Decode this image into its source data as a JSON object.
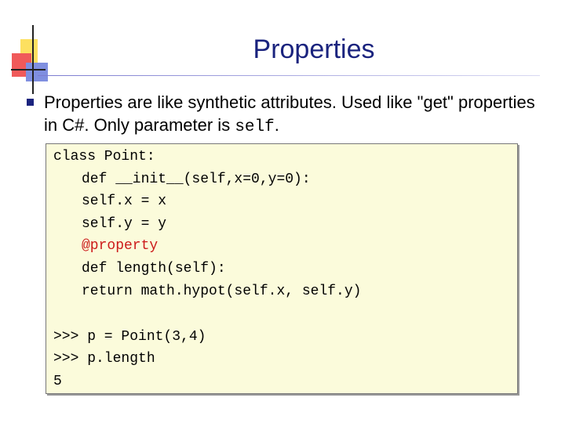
{
  "slide": {
    "title": "Properties",
    "intro_text": "Properties are like synthetic attributes.  Used like \"get\" properties in C#.  Only parameter is ",
    "intro_code": "self",
    "intro_end": "."
  },
  "code": {
    "lines": [
      "class Point:",
      "def __init__(self,x=0,y=0):",
      "self.x = x",
      "self.y = y",
      "@property",
      "def length(self):",
      "return math.hypot(self.x, self.y)",
      ">>> p = Point(3,4)",
      ">>> p.length",
      "5"
    ]
  },
  "colors": {
    "title": "#1a237e",
    "code_bg": "#fbfbdb",
    "decorator": "#cc1a1a"
  }
}
